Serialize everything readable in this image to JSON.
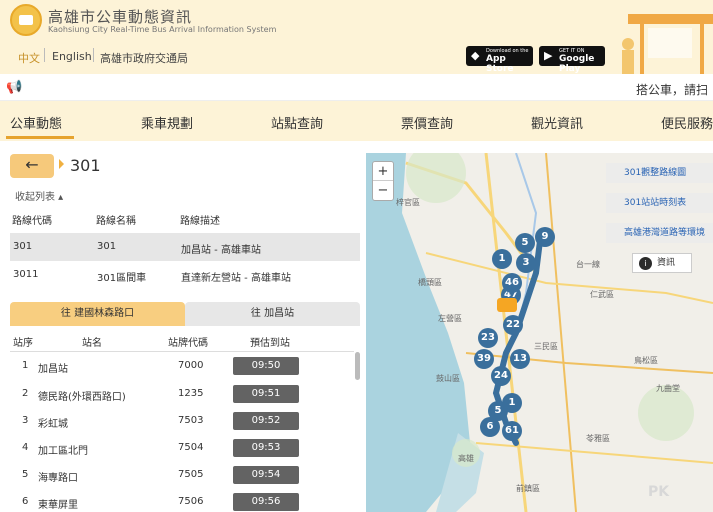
{
  "site": {
    "title": "高雄市公車動態資訊",
    "subtitle": "Kaohsiung City Real-Time Bus Arrival Information System"
  },
  "languages": [
    "中文",
    "English",
    "高雄市政府交通局"
  ],
  "stores": [
    {
      "small": "Download on the",
      "large": "App Store",
      "icon": "apple-icon"
    },
    {
      "small": "GET IT ON",
      "large": "Google Play",
      "icon": "google-play-icon"
    }
  ],
  "announcement": "搭公車，請扫",
  "nav": [
    "公車動態",
    "乘車規劃",
    "站點查詢",
    "票價查詢",
    "觀光資訊",
    "便民服務"
  ],
  "route_title": "301",
  "collapse_label": "收起列表 ▴",
  "route_table": {
    "headers": [
      "路線代碼",
      "路線名稱",
      "路線描述"
    ],
    "rows": [
      {
        "code": "301",
        "name": "301",
        "desc": "加昌站 - 高雄車站"
      },
      {
        "code": "3011",
        "name": "301區間車",
        "desc": "直達新左營站 - 高雄車站"
      }
    ]
  },
  "directions": [
    "往 建國林森路口",
    "往 加昌站"
  ],
  "stop_table": {
    "headers": [
      "站序",
      "站名",
      "站牌代碼",
      "預估到站"
    ],
    "rows": [
      {
        "seq": "1",
        "name": "加昌站",
        "code": "7000",
        "eta": "09:50"
      },
      {
        "seq": "2",
        "name": "德民路(外環西路口)",
        "code": "1235",
        "eta": "09:51"
      },
      {
        "seq": "3",
        "name": "彩虹城",
        "code": "7503",
        "eta": "09:52"
      },
      {
        "seq": "4",
        "name": "加工區北門",
        "code": "7504",
        "eta": "09:53"
      },
      {
        "seq": "5",
        "name": "海專路口",
        "code": "7505",
        "eta": "09:54"
      },
      {
        "seq": "6",
        "name": "東華屏里",
        "code": "7506",
        "eta": "09:56"
      }
    ]
  },
  "map": {
    "zoom_in": "+",
    "zoom_out": "−",
    "buttons": [
      "301觀整路線圖",
      "301站站時刻表",
      "高雄港灣道路等環境"
    ],
    "info_label": "資訊",
    "info_icon": "i",
    "labels": [
      "仁武區",
      "梓官區",
      "橋頭區",
      "左營區",
      "鼓山區",
      "苓雅區",
      "前鎮區",
      "三民區",
      "鳥松區",
      "台一線",
      "九曲堂",
      "高雄"
    ],
    "markers": [
      "9",
      "5",
      "1",
      "3",
      "47",
      "46",
      "22",
      "23",
      "39",
      "61",
      "24",
      "1",
      "5",
      "6",
      "13"
    ]
  },
  "watermark": "PK",
  "colors": {
    "header_bg": "#fdf3d7",
    "accent": "#e6a32e",
    "marker": "#3a6f9c",
    "eta_badge": "#636363"
  }
}
